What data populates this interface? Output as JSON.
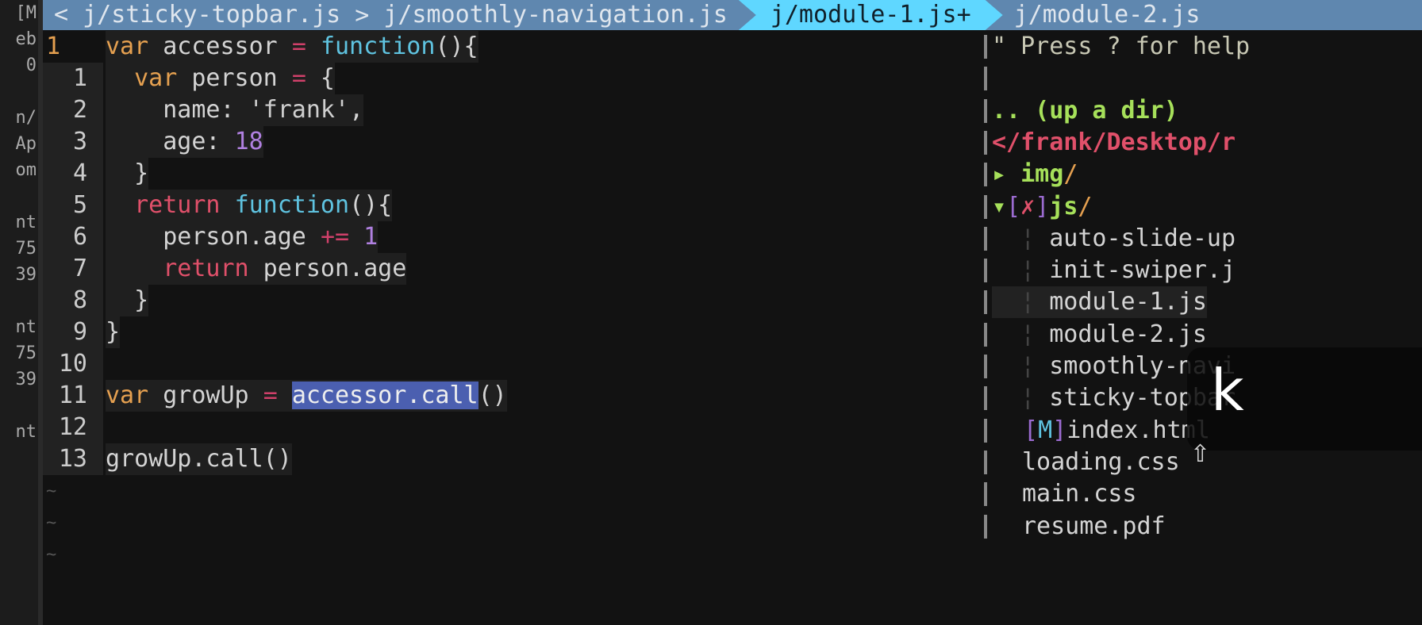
{
  "left_strip": [
    "[M",
    "eb",
    "0",
    "",
    "n/",
    "Ap",
    "om",
    "",
    "nt",
    "75",
    "39",
    "",
    "nt",
    "75",
    "39",
    "",
    "nt"
  ],
  "tabs": [
    {
      "label": "< j/sticky-topbar.js",
      "active": false
    },
    {
      "label": "j/smoothly-navigation.js",
      "active": false
    },
    {
      "label": "j/module-1.js+",
      "active": true
    },
    {
      "label": "j/module-2.js",
      "active": false
    }
  ],
  "tab_separator": ">",
  "editor": {
    "lines": [
      {
        "num": "1",
        "current": true,
        "tokens": [
          [
            "kw",
            "var"
          ],
          [
            "id",
            " accessor "
          ],
          [
            "op",
            "="
          ],
          [
            "id",
            " "
          ],
          [
            "fn",
            "function"
          ],
          [
            "id",
            "(){"
          ]
        ]
      },
      {
        "num": "1",
        "tokens": [
          [
            "id",
            "  "
          ],
          [
            "kw",
            "var"
          ],
          [
            "id",
            " person "
          ],
          [
            "op",
            "="
          ],
          [
            "id",
            " {"
          ]
        ]
      },
      {
        "num": "2",
        "tokens": [
          [
            "id",
            "    name: "
          ],
          [
            "str",
            "'frank'"
          ],
          [
            "id",
            ","
          ]
        ]
      },
      {
        "num": "3",
        "tokens": [
          [
            "id",
            "    age: "
          ],
          [
            "num",
            "18"
          ]
        ]
      },
      {
        "num": "4",
        "tokens": [
          [
            "id",
            "  }"
          ]
        ]
      },
      {
        "num": "5",
        "tokens": [
          [
            "id",
            "  "
          ],
          [
            "ret",
            "return"
          ],
          [
            "id",
            " "
          ],
          [
            "fn",
            "function"
          ],
          [
            "id",
            "(){"
          ]
        ]
      },
      {
        "num": "6",
        "tokens": [
          [
            "id",
            "    person.age "
          ],
          [
            "op",
            "+="
          ],
          [
            "id",
            " "
          ],
          [
            "num",
            "1"
          ]
        ]
      },
      {
        "num": "7",
        "tokens": [
          [
            "id",
            "    "
          ],
          [
            "ret",
            "return"
          ],
          [
            "id",
            " person.age"
          ]
        ]
      },
      {
        "num": "8",
        "tokens": [
          [
            "id",
            "  }"
          ]
        ]
      },
      {
        "num": "9",
        "tokens": [
          [
            "id",
            "}"
          ]
        ]
      },
      {
        "num": "10",
        "tokens": []
      },
      {
        "num": "11",
        "tokens": [
          [
            "kw",
            "var"
          ],
          [
            "id",
            " growUp "
          ],
          [
            "op",
            "="
          ],
          [
            "id",
            " "
          ],
          [
            "sel",
            "accessor.call"
          ],
          [
            "id",
            "()"
          ]
        ]
      },
      {
        "num": "12",
        "tokens": []
      },
      {
        "num": "13",
        "tokens": [
          [
            "id",
            "growUp.call()"
          ]
        ]
      }
    ],
    "tilde": "~"
  },
  "tree": {
    "help": "\" Press ? for help",
    "up": ".. (up a dir)",
    "root": "</frank/Desktop/r",
    "img": {
      "arrow": "▸",
      "name": "img",
      "slash": "/"
    },
    "js": {
      "arrow": "▾",
      "open": "[",
      "mark": "✗",
      "close": "]",
      "name": "js",
      "slash": "/"
    },
    "js_files": [
      "auto-slide-up",
      "init-swiper.j",
      "module-1.js",
      "module-2.js",
      "smoothly-navi",
      "sticky-topbar"
    ],
    "index": {
      "open": "[",
      "mark": "M",
      "close": "]",
      "name": "index.html"
    },
    "files": [
      "loading.css",
      "main.css",
      "resume.pdf"
    ]
  },
  "key_overlay": {
    "key": "k",
    "modifier": "⇧"
  }
}
